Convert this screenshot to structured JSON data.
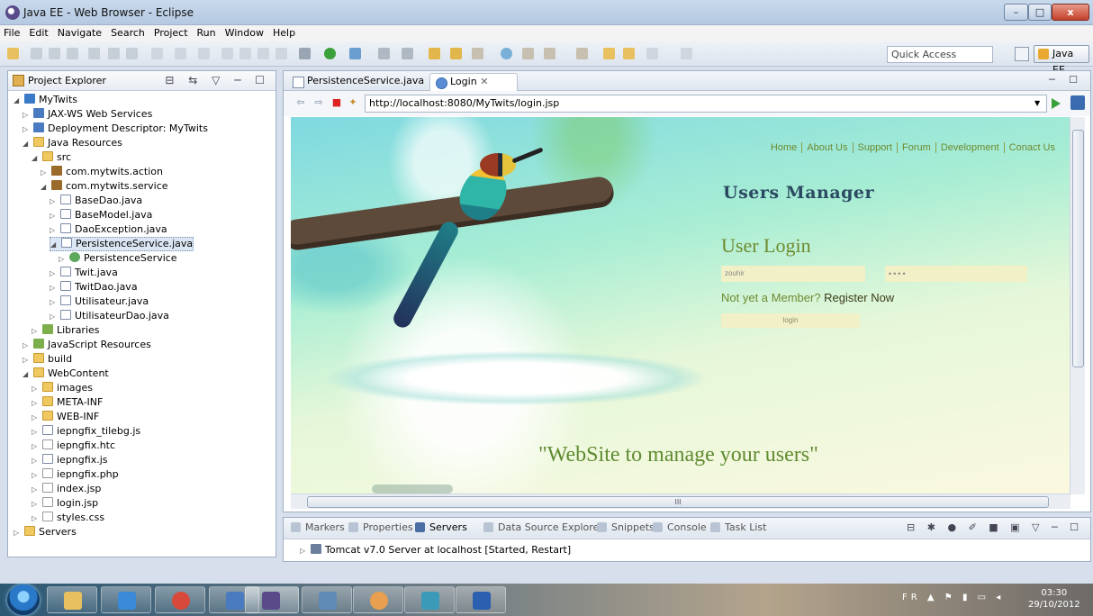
{
  "window": {
    "title": "Java EE - Web Browser - Eclipse",
    "minimize": "–",
    "maximize": "□",
    "close": "x"
  },
  "menu": [
    "File",
    "Edit",
    "Navigate",
    "Search",
    "Project",
    "Run",
    "Window",
    "Help"
  ],
  "toolbar": {
    "quick_access_placeholder": "Quick Access",
    "perspective": "Java EE"
  },
  "explorer": {
    "title": "Project Explorer",
    "tree": [
      {
        "label": "MyTwits",
        "icon": "project-icon",
        "open": true
      },
      {
        "label": "JAX-WS Web Services",
        "icon": "webservice-icon"
      },
      {
        "label": "Deployment Descriptor: MyTwits",
        "icon": "descriptor-icon"
      },
      {
        "label": "Java Resources",
        "icon": "java-resources-icon",
        "open": true
      },
      {
        "label": "src",
        "icon": "source-folder-icon",
        "open": true
      },
      {
        "label": "com.mytwits.action",
        "icon": "package-icon"
      },
      {
        "label": "com.mytwits.service",
        "icon": "package-icon",
        "open": true
      },
      {
        "label": "BaseDao.java",
        "icon": "java-file-icon"
      },
      {
        "label": "BaseModel.java",
        "icon": "java-file-icon"
      },
      {
        "label": "DaoException.java",
        "icon": "java-file-icon"
      },
      {
        "label": "PersistenceService.java",
        "icon": "java-file-icon",
        "open": true,
        "selected": true
      },
      {
        "label": "PersistenceService",
        "icon": "class-icon"
      },
      {
        "label": "Twit.java",
        "icon": "java-file-icon"
      },
      {
        "label": "TwitDao.java",
        "icon": "java-file-icon"
      },
      {
        "label": "Utilisateur.java",
        "icon": "java-file-icon"
      },
      {
        "label": "UtilisateurDao.java",
        "icon": "java-file-icon"
      },
      {
        "label": "Libraries",
        "icon": "library-icon"
      },
      {
        "label": "JavaScript Resources",
        "icon": "library-icon"
      },
      {
        "label": "build",
        "icon": "folder-icon"
      },
      {
        "label": "WebContent",
        "icon": "folder-icon",
        "open": true
      },
      {
        "label": "images",
        "icon": "folder-icon"
      },
      {
        "label": "META-INF",
        "icon": "folder-icon"
      },
      {
        "label": "WEB-INF",
        "icon": "folder-icon"
      },
      {
        "label": "iepngfix_tilebg.js",
        "icon": "js-file-icon"
      },
      {
        "label": "iepngfix.htc",
        "icon": "file-icon"
      },
      {
        "label": "iepngfix.js",
        "icon": "js-file-icon"
      },
      {
        "label": "iepngfix.php",
        "icon": "file-icon"
      },
      {
        "label": "index.jsp",
        "icon": "jsp-file-icon"
      },
      {
        "label": "login.jsp",
        "icon": "jsp-file-icon"
      },
      {
        "label": "styles.css",
        "icon": "file-icon"
      },
      {
        "label": "Servers",
        "icon": "folder-icon"
      }
    ]
  },
  "editor": {
    "tabs": [
      {
        "label": "PersistenceService.java",
        "active": false
      },
      {
        "label": "Login",
        "active": true
      }
    ],
    "url": "http://localhost:8080/MyTwits/login.jsp",
    "scroll_label": "III"
  },
  "page": {
    "nav": [
      "Home",
      "About Us",
      "Support",
      "Forum",
      "Development",
      "Conact Us"
    ],
    "site_title": "Users Manager",
    "heading": "User Login",
    "username_value": "zouhir",
    "password_value": "••••",
    "not_member_text": "Not yet a Member?",
    "register_link": "Register Now",
    "login_button": "login",
    "tagline": "\"WebSite to manage your users\""
  },
  "bottom": {
    "tabs": [
      "Markers",
      "Properties",
      "Servers",
      "Data Source Explorer",
      "Snippets",
      "Console",
      "Task List"
    ],
    "server": "Tomcat v7.0 Server at localhost  [Started, Restart]"
  },
  "taskbar": {
    "lang": "FR",
    "time": "03:30",
    "date": "29/10/2012"
  }
}
